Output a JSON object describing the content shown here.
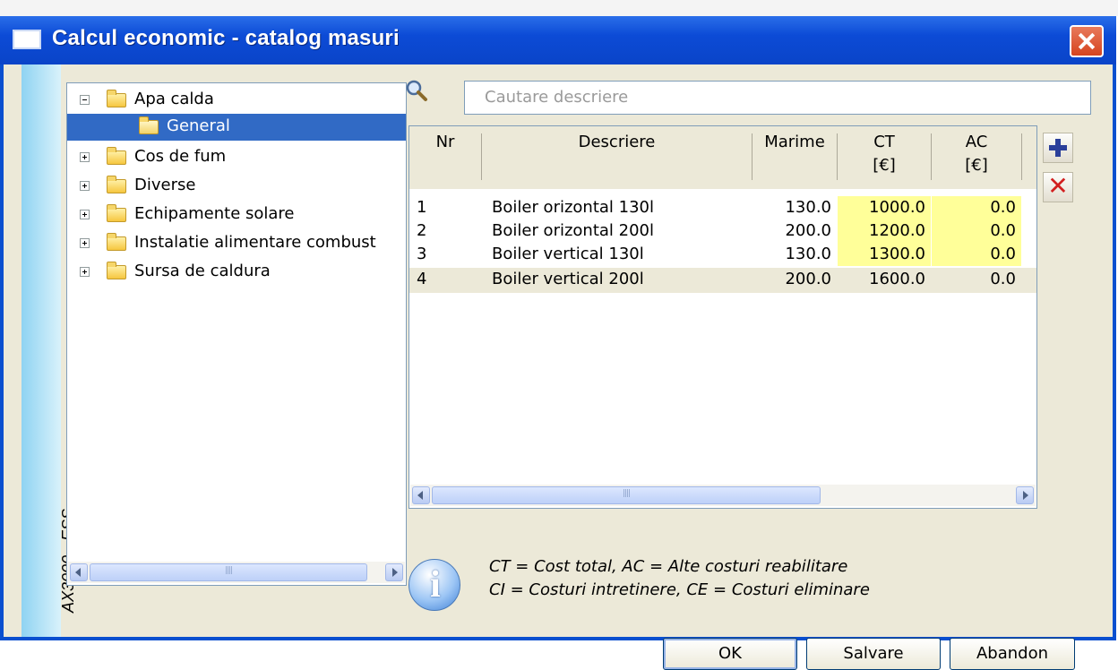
{
  "window": {
    "title": "Calcul economic - catalog masuri",
    "side_label": "AX3000 - ESS"
  },
  "tree": {
    "items": [
      {
        "label": "Apa calda",
        "expander": "minus"
      },
      {
        "label": "General",
        "selected": true
      },
      {
        "label": "Cos de fum",
        "expander": "plus"
      },
      {
        "label": "Diverse",
        "expander": "plus"
      },
      {
        "label": "Echipamente solare",
        "expander": "plus"
      },
      {
        "label": "Instalatie alimentare combust",
        "expander": "plus"
      },
      {
        "label": "Sursa de caldura",
        "expander": "plus"
      }
    ]
  },
  "search": {
    "placeholder": "Cautare descriere"
  },
  "grid": {
    "columns": [
      {
        "line1": "Nr",
        "line2": ""
      },
      {
        "line1": "Descriere",
        "line2": ""
      },
      {
        "line1": "Marime",
        "line2": ""
      },
      {
        "line1": "CT",
        "line2": "[€]"
      },
      {
        "line1": "AC",
        "line2": "[€]"
      }
    ],
    "rows": [
      {
        "nr": "1",
        "descriere": "Boiler orizontal 130l",
        "marime": "130.0",
        "ct": "1000.0",
        "ac": "0.0"
      },
      {
        "nr": "2",
        "descriere": "Boiler orizontal 200l",
        "marime": "200.0",
        "ct": "1200.0",
        "ac": "0.0"
      },
      {
        "nr": "3",
        "descriere": "Boiler vertical 130l",
        "marime": "130.0",
        "ct": "1300.0",
        "ac": "0.0"
      },
      {
        "nr": "4",
        "descriere": "Boiler vertical 200l",
        "marime": "200.0",
        "ct": "1600.0",
        "ac": "0.0"
      }
    ]
  },
  "legend": {
    "line1": "CT = Cost total, AC = Alte costuri reabilitare",
    "line2": "CI = Costuri intretinere, CE = Costuri eliminare"
  },
  "buttons": {
    "ok": "OK",
    "save": "Salvare",
    "cancel": "Abandon"
  },
  "colors": {
    "titlebar": "#0a4fcf",
    "selection": "#316ac5",
    "highlight_cell": "#ffff99",
    "dialog_bg": "#ece9d8"
  },
  "icons": [
    "app-icon",
    "close-icon",
    "folder-icon",
    "search-icon",
    "add-icon",
    "delete-icon",
    "info-icon"
  ]
}
